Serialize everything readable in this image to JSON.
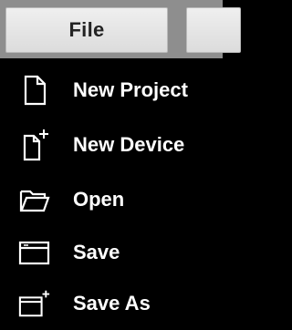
{
  "menubar": {
    "file_label": "File"
  },
  "menu": {
    "items": [
      {
        "label": "New Project",
        "icon": "new-project-icon"
      },
      {
        "label": "New Device",
        "icon": "new-device-icon"
      },
      {
        "label": "Open",
        "icon": "folder-open-icon"
      },
      {
        "label": "Save",
        "icon": "save-window-icon"
      },
      {
        "label": "Save As",
        "icon": "save-as-window-icon"
      }
    ]
  },
  "colors": {
    "menu_background": "#000000",
    "menu_text": "#ffffff",
    "menubar_background": "#8e8e8e",
    "tab_background": "#e6e6e6"
  }
}
